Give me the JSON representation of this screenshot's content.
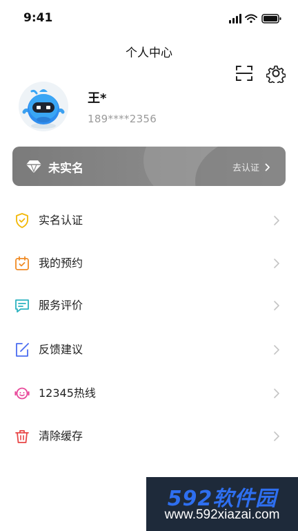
{
  "status_bar": {
    "time": "9:41"
  },
  "header": {
    "title": "个人中心"
  },
  "icons": {
    "scan": "scan-icon",
    "settings": "gear-icon",
    "avatar": "robot-avatar",
    "diamond": "diamond-icon"
  },
  "profile": {
    "name": "王*",
    "phone": "189****2356"
  },
  "verify_banner": {
    "status": "未实名",
    "action": "去认证"
  },
  "menu": [
    {
      "label": "实名认证",
      "icon": "shield-check-icon",
      "color": "#f2b705"
    },
    {
      "label": "我的预约",
      "icon": "calendar-check-icon",
      "color": "#f08a24"
    },
    {
      "label": "服务评价",
      "icon": "chat-bubble-icon",
      "color": "#2bb3c0"
    },
    {
      "label": "反馈建议",
      "icon": "edit-icon",
      "color": "#4a6cf0"
    },
    {
      "label": "12345热线",
      "icon": "hotline-icon",
      "color": "#e8489a"
    },
    {
      "label": "清除缓存",
      "icon": "trash-icon",
      "color": "#e84545"
    }
  ],
  "watermark": {
    "brand": "592软件园",
    "url": "www.592xiazai.com"
  }
}
